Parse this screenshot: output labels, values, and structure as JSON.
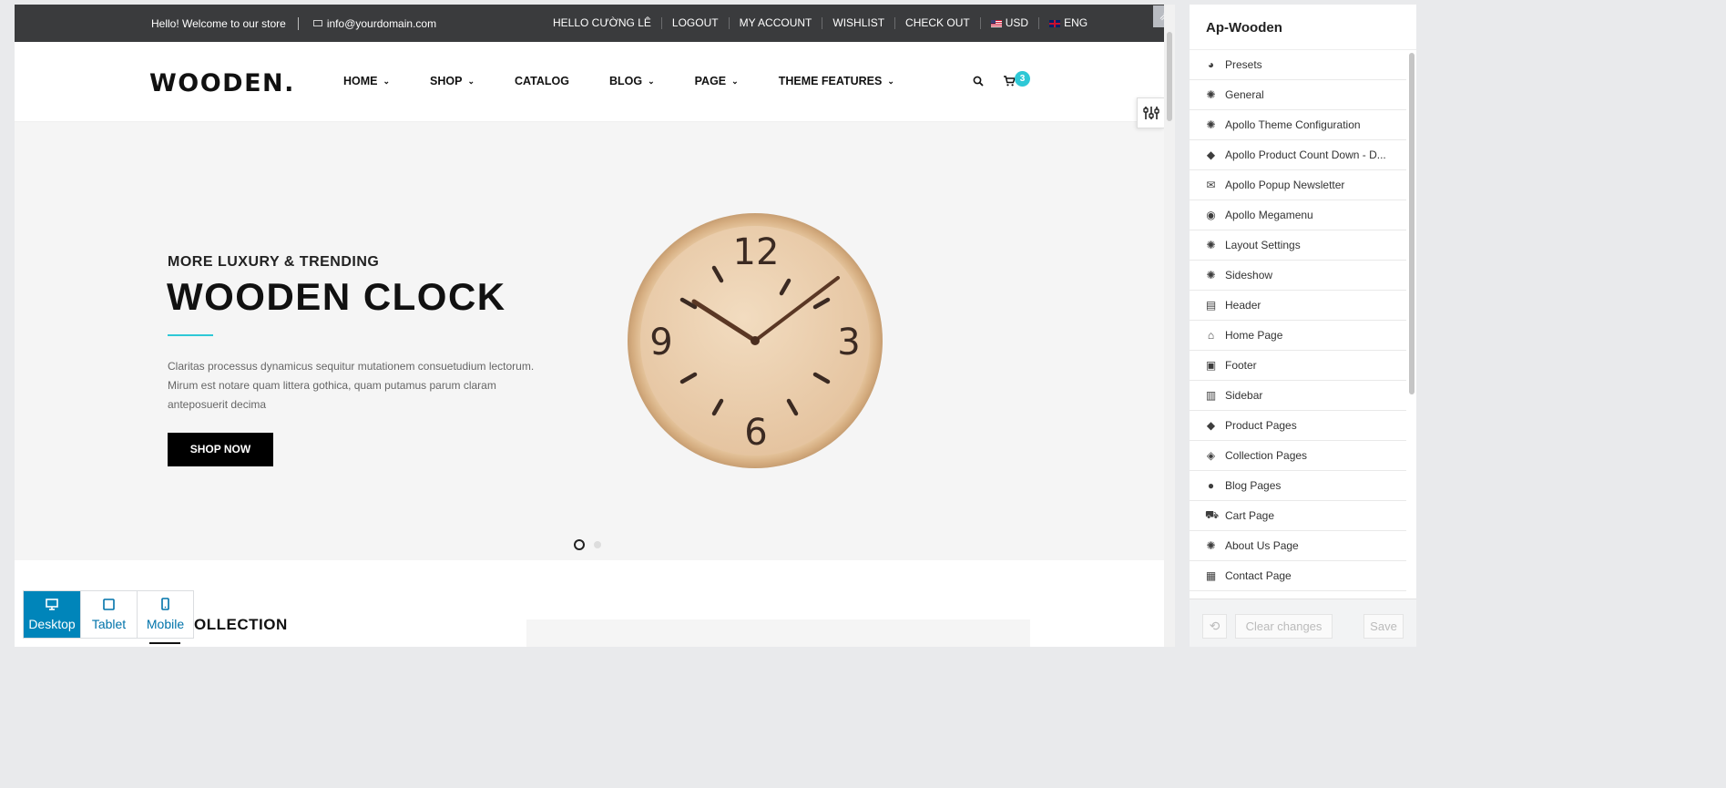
{
  "topbar": {
    "welcome": "Hello! Welcome to our store",
    "email": "info@yourdomain.com",
    "links": [
      "HELLO CƯỜNG LÊ",
      "LOGOUT",
      "MY ACCOUNT",
      "WISHLIST",
      "CHECK OUT"
    ],
    "currency": "USD",
    "language": "ENG"
  },
  "header": {
    "logo": "WOODEN.",
    "nav": [
      {
        "label": "HOME",
        "dropdown": true
      },
      {
        "label": "SHOP",
        "dropdown": true
      },
      {
        "label": "CATALOG",
        "dropdown": false
      },
      {
        "label": "BLOG",
        "dropdown": true
      },
      {
        "label": "PAGE",
        "dropdown": true
      },
      {
        "label": "THEME FEATURES",
        "dropdown": true
      }
    ],
    "cart_count": "3"
  },
  "slide": {
    "subtitle": "MORE LUXURY & TRENDING",
    "title": "WOODEN CLOCK",
    "description": "Claritas processus dynamicus sequitur mutationem consuetudium lectorum. Mirum est notare quam littera gothica, quam putamus parum claram anteposuerit decima",
    "button": "SHOP NOW",
    "clock_numbers": [
      "12",
      "3",
      "6",
      "9"
    ],
    "dots_total": 2,
    "dots_active": 1
  },
  "section": {
    "collection_label": "OLLECTION"
  },
  "devices": [
    {
      "label": "Desktop",
      "icon": "desktop-icon",
      "active": true
    },
    {
      "label": "Tablet",
      "icon": "tablet-icon",
      "active": false
    },
    {
      "label": "Mobile",
      "icon": "mobile-icon",
      "active": false
    }
  ],
  "panel": {
    "title": "Ap-Wooden",
    "items": [
      {
        "label": "Presets",
        "icon": "palette-icon"
      },
      {
        "label": "General",
        "icon": "gear-icon"
      },
      {
        "label": "Apollo Theme Configuration",
        "icon": "gear-icon"
      },
      {
        "label": "Apollo Product Count Down - D...",
        "icon": "tag-icon"
      },
      {
        "label": "Apollo Popup Newsletter",
        "icon": "envelope-icon"
      },
      {
        "label": "Apollo Megamenu",
        "icon": "compass-icon"
      },
      {
        "label": "Layout Settings",
        "icon": "gear-icon"
      },
      {
        "label": "Sideshow",
        "icon": "gear-icon"
      },
      {
        "label": "Header",
        "icon": "header-layout-icon"
      },
      {
        "label": "Home Page",
        "icon": "home-icon"
      },
      {
        "label": "Footer",
        "icon": "footer-layout-icon"
      },
      {
        "label": "Sidebar",
        "icon": "sidebar-layout-icon"
      },
      {
        "label": "Product Pages",
        "icon": "tag-icon"
      },
      {
        "label": "Collection Pages",
        "icon": "tags-icon"
      },
      {
        "label": "Blog Pages",
        "icon": "comment-icon"
      },
      {
        "label": "Cart Page",
        "icon": "cart-icon"
      },
      {
        "label": "About Us Page",
        "icon": "gear-icon"
      },
      {
        "label": "Contact Page",
        "icon": "contact-card-icon"
      }
    ],
    "undo": "⟲",
    "clear": "Clear changes",
    "save": "Save"
  },
  "colors": {
    "accent": "#2ec8d6",
    "topbar": "#3a3b3d",
    "device_active": "#0085ba"
  }
}
